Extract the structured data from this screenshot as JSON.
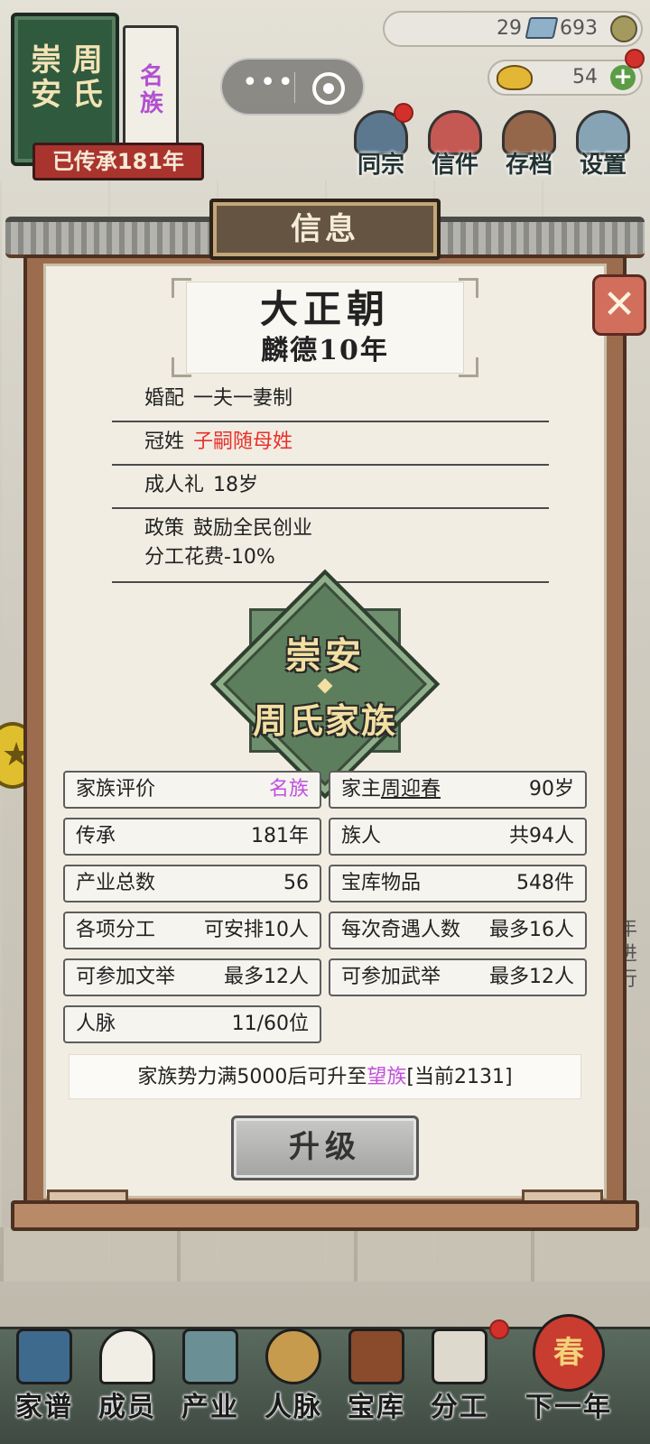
{
  "header": {
    "book": {
      "cover_title": "崇安周氏",
      "cover_line1": "崇 周",
      "cover_line2": "安 氏",
      "rank": "名族",
      "rank_line1": "名",
      "rank_line2": "族",
      "inherited": "已传承181年"
    },
    "resources": {
      "tickets": "29",
      "coins": "693",
      "gold": "54"
    },
    "menu": [
      {
        "label": "同宗",
        "icon": "clan-icon"
      },
      {
        "label": "信件",
        "icon": "letter-icon"
      },
      {
        "label": "存档",
        "icon": "archive-icon"
      },
      {
        "label": "设置",
        "icon": "settings-icon"
      }
    ]
  },
  "panel": {
    "title": "信息",
    "close_glyph": "✕",
    "dynasty": {
      "name": "大正朝",
      "era": "麟德10年"
    },
    "rules": [
      {
        "label": "婚配",
        "value": "一夫一妻制"
      },
      {
        "label": "冠姓",
        "value": "子嗣随母姓",
        "color": "#e8302a"
      },
      {
        "label": "成人礼",
        "value": "18岁"
      },
      {
        "label": "政策",
        "value": "鼓励全民创业",
        "extra": "分工花费-10%"
      }
    ],
    "emblem": {
      "line1": "崇安",
      "line2": "周氏家族"
    },
    "stats": {
      "rating_label": "家族评价",
      "rating_value": "名族",
      "head_label": "家主",
      "head_name": "周迎春",
      "head_age": "90岁",
      "inherit_label": "传承",
      "inherit_value": "181年",
      "members_label": "族人",
      "members_value": "共94人",
      "industry_label": "产业总数",
      "industry_value": "56",
      "treasury_label": "宝库物品",
      "treasury_value": "548件",
      "division_label": "各项分工",
      "division_value": "可安排10人",
      "encounter_label": "每次奇遇人数",
      "encounter_value": "最多16人",
      "civil_label": "可参加文举",
      "civil_value": "最多12人",
      "military_label": "可参加武举",
      "military_value": "最多12人",
      "network_label": "人脉",
      "network_value": "11/60位"
    },
    "upgrade_note": {
      "prefix": "家族势力满5000后可升至",
      "target": "望族",
      "suffix": "[当前2131]"
    },
    "upgrade_button": "升级"
  },
  "nav": [
    {
      "label": "家谱",
      "icon": "genealogy-icon"
    },
    {
      "label": "成员",
      "icon": "members-icon"
    },
    {
      "label": "产业",
      "icon": "industry-icon"
    },
    {
      "label": "人脉",
      "icon": "network-icon"
    },
    {
      "label": "宝库",
      "icon": "treasury-icon"
    },
    {
      "label": "分工",
      "icon": "division-icon"
    },
    {
      "label": "下一年",
      "icon": "next-year-icon",
      "badge": "春"
    }
  ],
  "side": {
    "note_line1": "年",
    "note_line2": "进行"
  },
  "colors": {
    "accent_red": "#e8302a",
    "rank_purple": "#c24fe0",
    "panel_paper": "#f1ede3",
    "emblem_green": "#5d7e5d"
  }
}
